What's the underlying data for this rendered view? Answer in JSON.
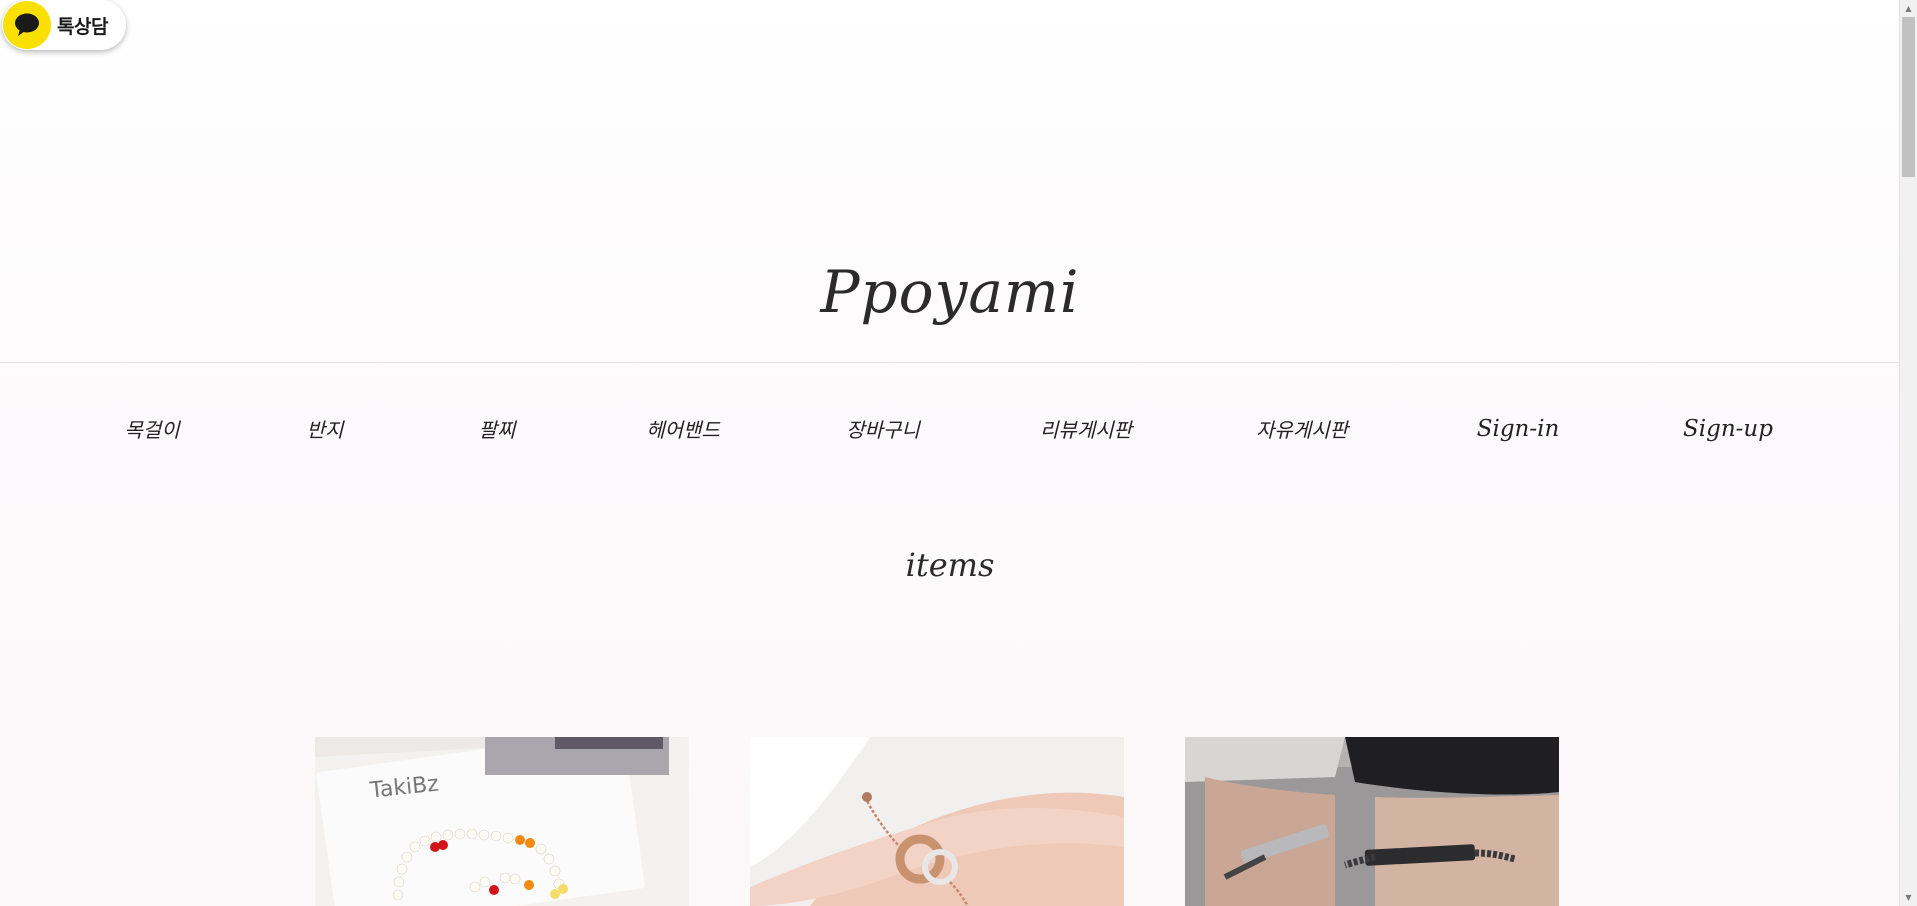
{
  "chat_widget": {
    "label": "톡상담",
    "icon": "speech-bubble-icon",
    "color": "#f9e000"
  },
  "header": {
    "logo": "Ppoyami"
  },
  "nav": {
    "items": [
      {
        "id": "necklace",
        "label": "목걸이"
      },
      {
        "id": "ring",
        "label": "반지"
      },
      {
        "id": "bracelet",
        "label": "팔찌"
      },
      {
        "id": "hairband",
        "label": "헤어밴드"
      },
      {
        "id": "cart",
        "label": "장바구니"
      },
      {
        "id": "review-board",
        "label": "리뷰게시판"
      },
      {
        "id": "free-board",
        "label": "자유게시판"
      },
      {
        "id": "sign-in",
        "label": "Sign-in"
      },
      {
        "id": "sign-up",
        "label": "Sign-up"
      }
    ]
  },
  "section": {
    "title": "items"
  },
  "products": [
    {
      "image": "pearl-bracelet-photo",
      "card_text": "TakiBz"
    },
    {
      "image": "rose-gold-bracelet-photo"
    },
    {
      "image": "couple-bar-bracelet-photo"
    }
  ]
}
